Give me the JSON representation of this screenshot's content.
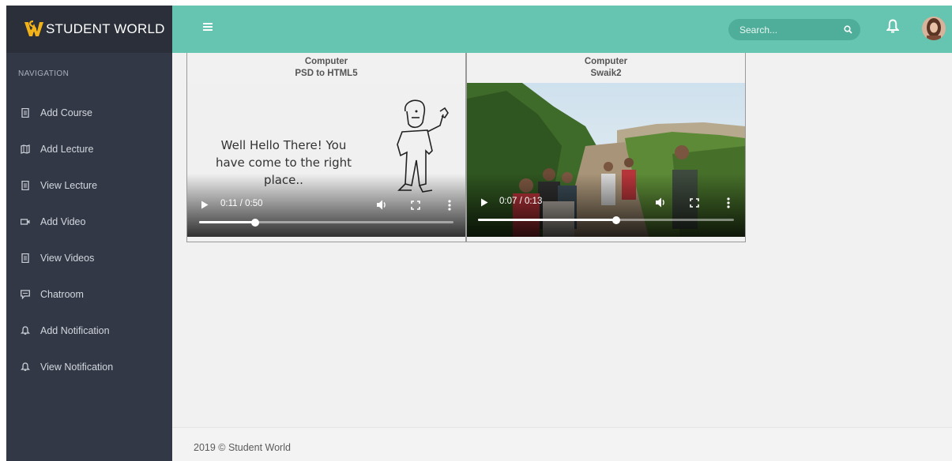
{
  "brand": {
    "name": "STUDENT WORLD"
  },
  "sidebar": {
    "heading": "NAVIGATION",
    "items": [
      {
        "label": "Add Course",
        "icon": "document-icon"
      },
      {
        "label": "Add Lecture",
        "icon": "map-icon"
      },
      {
        "label": "View Lecture",
        "icon": "document-icon"
      },
      {
        "label": "Add Video",
        "icon": "video-icon"
      },
      {
        "label": "View Videos",
        "icon": "document-icon"
      },
      {
        "label": "Chatroom",
        "icon": "chat-icon"
      },
      {
        "label": "Add Notification",
        "icon": "bell-icon"
      },
      {
        "label": "View Notification",
        "icon": "bell-icon"
      }
    ]
  },
  "header": {
    "search": {
      "placeholder": "Search..."
    }
  },
  "videos": [
    {
      "category": "Computer",
      "title": "PSD to HTML5",
      "time": "0:11 / 0:50",
      "progress": 0.22,
      "frame_text": "Well Hello There! You have come to the right place.."
    },
    {
      "category": "Computer",
      "title": "Swaik2",
      "time": "0:07 / 0:13",
      "progress": 0.54
    }
  ],
  "footer": {
    "text": "2019 © Student World"
  },
  "colors": {
    "sidebar": "#323846",
    "brand_bar": "#2a2f3a",
    "header": "#66c5b0",
    "search_bg": "#4fae99",
    "content_bg": "#f1f1f1"
  }
}
